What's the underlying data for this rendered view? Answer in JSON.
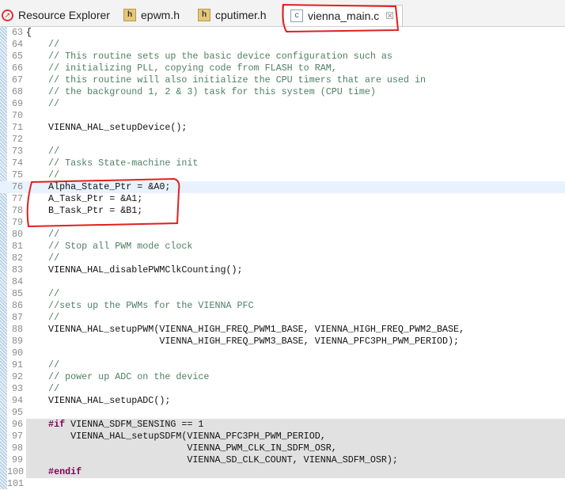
{
  "tabs": [
    {
      "label": "Resource Explorer",
      "icon": "compass-icon"
    },
    {
      "label": "epwm.h",
      "icon": "header-file-icon"
    },
    {
      "label": "cputimer.h",
      "icon": "header-file-icon"
    },
    {
      "label": "vienna_main.c",
      "icon": "c-file-icon",
      "active": true
    }
  ],
  "lines": [
    {
      "n": "63",
      "t": "{"
    },
    {
      "n": "64",
      "t": "    //",
      "c": "cm"
    },
    {
      "n": "65",
      "t": "    // This routine sets up the basic device configuration such as",
      "c": "cm"
    },
    {
      "n": "66",
      "t": "    // initializing PLL, copying code from FLASH to RAM,",
      "c": "cm"
    },
    {
      "n": "67",
      "t": "    // this routine will also initialize the CPU timers that are used in",
      "c": "cm"
    },
    {
      "n": "68",
      "t": "    // the background 1, 2 & 3) task for this system (CPU time)",
      "c": "cm"
    },
    {
      "n": "69",
      "t": "    //",
      "c": "cm"
    },
    {
      "n": "70",
      "t": ""
    },
    {
      "n": "71",
      "t": "    VIENNA_HAL_setupDevice();"
    },
    {
      "n": "72",
      "t": ""
    },
    {
      "n": "73",
      "t": "    //",
      "c": "cm"
    },
    {
      "n": "74",
      "t": "    // Tasks State-machine init",
      "c": "cm"
    },
    {
      "n": "75",
      "t": "    //",
      "c": "cm"
    },
    {
      "n": "76",
      "t": "    Alpha_State_Ptr = &A0;",
      "cur": true
    },
    {
      "n": "77",
      "t": "    A_Task_Ptr = &A1;"
    },
    {
      "n": "78",
      "t": "    B_Task_Ptr = &B1;"
    },
    {
      "n": "79",
      "t": ""
    },
    {
      "n": "80",
      "t": "    //",
      "c": "cm"
    },
    {
      "n": "81",
      "t": "    // Stop all PWM mode clock",
      "c": "cm"
    },
    {
      "n": "82",
      "t": "    //",
      "c": "cm"
    },
    {
      "n": "83",
      "t": "    VIENNA_HAL_disablePWMClkCounting();"
    },
    {
      "n": "84",
      "t": ""
    },
    {
      "n": "85",
      "t": "    //",
      "c": "cm"
    },
    {
      "n": "86",
      "t": "    //sets up the PWMs for the VIENNA PFC",
      "c": "cm"
    },
    {
      "n": "87",
      "t": "    //",
      "c": "cm"
    },
    {
      "n": "88",
      "t": "    VIENNA_HAL_setupPWM(VIENNA_HIGH_FREQ_PWM1_BASE, VIENNA_HIGH_FREQ_PWM2_BASE,"
    },
    {
      "n": "89",
      "t": "                        VIENNA_HIGH_FREQ_PWM3_BASE, VIENNA_PFC3PH_PWM_PERIOD);"
    },
    {
      "n": "90",
      "t": ""
    },
    {
      "n": "91",
      "t": "    //",
      "c": "cm"
    },
    {
      "n": "92",
      "t": "    // power up ADC on the device",
      "c": "cm"
    },
    {
      "n": "93",
      "t": "    //",
      "c": "cm"
    },
    {
      "n": "94",
      "t": "    VIENNA_HAL_setupADC();"
    },
    {
      "n": "95",
      "t": ""
    },
    {
      "n": "96",
      "k": "    #if",
      "t": " VIENNA_SDFM_SENSING == 1",
      "gray": true
    },
    {
      "n": "97",
      "t": "        VIENNA_HAL_setupSDFM(VIENNA_PFC3PH_PWM_PERIOD,",
      "gray": true
    },
    {
      "n": "98",
      "t": "                             VIENNA_PWM_CLK_IN_SDFM_OSR,",
      "gray": true
    },
    {
      "n": "99",
      "t": "                             VIENNA_SD_CLK_COUNT, VIENNA_SDFM_OSR);",
      "gray": true
    },
    {
      "n": "100",
      "k": "    #endif",
      "t": "",
      "gray": true
    },
    {
      "n": "101",
      "t": ""
    }
  ]
}
